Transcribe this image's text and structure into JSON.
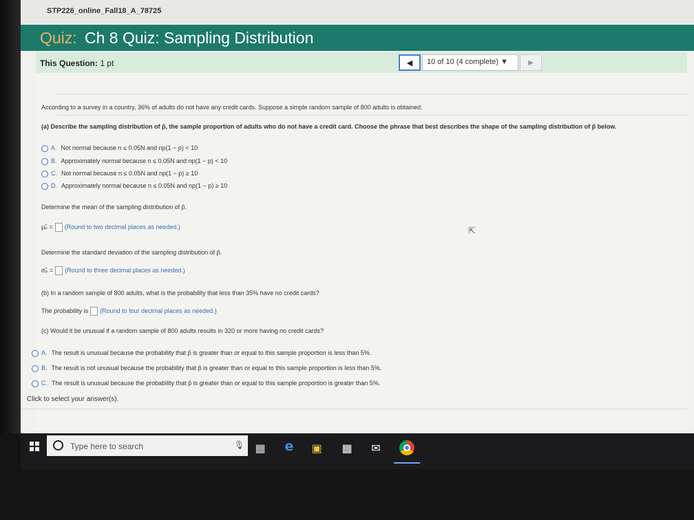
{
  "course": {
    "title": "STP226_online_Fall18_A_78725"
  },
  "quiz": {
    "prefix": "Quiz:",
    "title": "Ch 8 Quiz: Sampling Distribution"
  },
  "question_bar": {
    "label": "This Question:",
    "points": "1 pt",
    "nav_status": "10 of 10 (4 complete) ▼",
    "prev_icon": "◀",
    "next_icon": "▶"
  },
  "problem": {
    "intro": "According to a survey in a country, 36% of adults do not have any credit cards. Suppose a simple random sample of 800 adults is obtained.",
    "part_a": {
      "prompt": "(a) Describe the sampling distribution of p̂, the sample proportion of adults who do not have a credit card. Choose the phrase that best describes the shape of the sampling distribution of p̂ below.",
      "options": [
        {
          "letter": "A.",
          "text": "Not normal because n ≤ 0.05N and np(1 − p) < 10"
        },
        {
          "letter": "B.",
          "text": "Approximately normal because n ≤ 0.05N and np(1 − p) < 10"
        },
        {
          "letter": "C.",
          "text": "Not normal because n ≤ 0.05N and np(1 − p) ≥ 10"
        },
        {
          "letter": "D.",
          "text": "Approximately normal because n ≤ 0.05N and np(1 − p) ≥ 10"
        }
      ],
      "mean_prompt": "Determine the mean of the sampling distribution of p̂.",
      "mean_symbol": "μₚ̂ =",
      "mean_hint": "(Round to two decimal places as needed.)",
      "sd_prompt": "Determine the standard deviation of the sampling distribution of p̂.",
      "sd_symbol": "σₚ̂ =",
      "sd_hint": "(Round to three decimal places as needed.)"
    },
    "part_b": {
      "prompt": "(b) In a random sample of 800 adults, what is the probability that less than 35% have no credit cards?",
      "answer_label": "The probability is",
      "hint": "(Round to four decimal places as needed.)"
    },
    "part_c": {
      "prompt": "(c) Would it be unusual if a random sample of 800 adults results in 320 or more having no credit cards?",
      "options": [
        {
          "letter": "A.",
          "text": "The result is unusual because the probability that p̂ is greater than or equal to this sample proportion is less than 5%."
        },
        {
          "letter": "B.",
          "text": "The result is not unusual because the probability that p̂ is greater than or equal to this sample proportion is less than 5%."
        },
        {
          "letter": "C.",
          "text": "The result is unusual because the probability that p̂ is greater than or equal to this sample proportion is greater than 5%."
        }
      ]
    },
    "footer": "Click to select your answer(s)."
  },
  "taskbar": {
    "search_placeholder": "Type here to search"
  }
}
